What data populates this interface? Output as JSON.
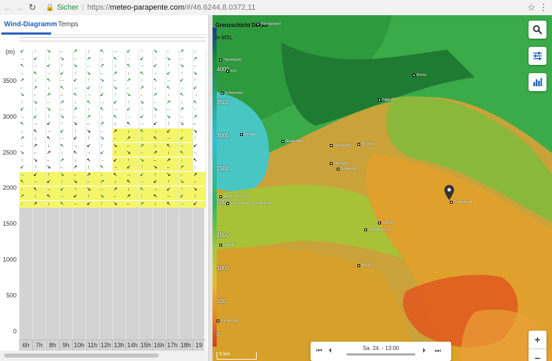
{
  "browser": {
    "back": "←",
    "forward": "→",
    "reload": "↻",
    "secure_label": "Sicher",
    "url_scheme": "https://",
    "url_host": "meteo-parapente.com",
    "url_path": "/#/46.6244,8.0372,11",
    "star": "☆",
    "menu": "⋮"
  },
  "tabs": [
    {
      "label": "Wind-Diagramm",
      "active": true
    },
    {
      "label": "Temps",
      "active": false
    }
  ],
  "chart": {
    "unit": "(m)",
    "y_ticks": [
      "3500",
      "3000",
      "2500",
      "2000",
      "1500",
      "1000",
      "500",
      "0"
    ],
    "hours": [
      "6h",
      "7h",
      "8h",
      "9h",
      "10h",
      "11h",
      "12h",
      "13h",
      "14h",
      "15h",
      "16h",
      "17h",
      "18h",
      "19"
    ]
  },
  "map": {
    "legend_title": "Grenzschicht Decke",
    "legend_unit": "m MSL",
    "levels": [
      "4000",
      "3500",
      "3000",
      "2500",
      "2000",
      "1500",
      "1000",
      "500",
      "0"
    ],
    "scale": "5 km",
    "places": [
      {
        "name": "Wachseldorn"
      },
      {
        "name": "Horrenbach"
      },
      {
        "name": "Eriz"
      },
      {
        "name": "Schwanden"
      },
      {
        "name": "Merligen"
      },
      {
        "name": "Beatenberg"
      },
      {
        "name": "Habkern"
      },
      {
        "name": "Interlaken"
      },
      {
        "name": "Wilderswil"
      },
      {
        "name": "Lauterbrunnen"
      },
      {
        "name": "Wengen"
      },
      {
        "name": "Grindelwald"
      },
      {
        "name": "Mürren"
      },
      {
        "name": "Kandersteg"
      },
      {
        "name": "Brienz"
      },
      {
        "name": "Kiental"
      },
      {
        "name": "Aeschi bei Spiez"
      },
      {
        "name": "Reichenbach im Kandertal"
      },
      {
        "name": "Gsteigwiler"
      },
      {
        "name": "Bönigen"
      }
    ]
  },
  "player": {
    "time": "Sa. 24. - 13:00",
    "first": "⏮",
    "prev": "⏴",
    "next": "⏵",
    "last": "⏭"
  },
  "zoom": {
    "in": "+",
    "out": "−"
  },
  "colors": {
    "accent": "#1f5fbf",
    "wind_arrow": "#2a8a3a",
    "yellow_zone": "#f5f56a"
  }
}
